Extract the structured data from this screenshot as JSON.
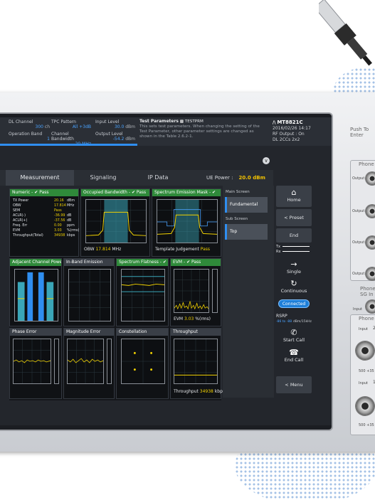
{
  "params": {
    "dl_channel_label": "DL Channel",
    "dl_channel_value": "300",
    "dl_channel_unit": "ch",
    "operation_band_label": "Operation Band",
    "operation_band_value": "1",
    "tpc_pattern_label": "TPC Pattern",
    "tpc_pattern_value": "All +3dB",
    "channel_bandwidth_label": "Channel Bandwidth",
    "channel_bandwidth_value": "20 MHz",
    "input_level_label": "Input Level",
    "input_level_value": "30.0",
    "input_level_unit": "dBm",
    "output_level_label": "Output Level",
    "output_level_value": "-54.2",
    "output_level_unit": "dBm"
  },
  "test_parameters": {
    "title": "Test Parameters",
    "code": "TESTPRM",
    "description": "This sets test parameters. When changing the setting of the Test Parameter, other parameter settings are changed as shown in the Table 2.6.2-1."
  },
  "device": {
    "model": "MT8821C",
    "date": "2016/02/26 14:17",
    "rf_output": "RF Output : On",
    "dl_mode": "DL 2CCs 2x2"
  },
  "tabs": [
    {
      "label": "Measurement"
    },
    {
      "label": "Signaling"
    },
    {
      "label": "IP Data"
    }
  ],
  "ue_power": {
    "label": "UE Power :",
    "value": "20.0 dBm"
  },
  "panels": {
    "numeric": {
      "title": "Numeric -",
      "status": "Pass"
    },
    "obw": {
      "title": "Occupied Bandwidth -",
      "status": "Pass",
      "label": "OBW",
      "value": "17.814",
      "unit": "MHz"
    },
    "sem": {
      "title": "Spectrum Emission Mask -",
      "status": "",
      "label": "Template Judgement",
      "value": "Pass"
    },
    "aclr": {
      "title": "Adjacent Channel Power"
    },
    "inband": {
      "title": "In-Band Emission"
    },
    "flatness": {
      "title": "Spectrum Flatness -"
    },
    "evm": {
      "title": "EVM -",
      "status": "Pass",
      "label": "EVM",
      "value": "3.03",
      "unit": "%(rms)"
    },
    "phase": {
      "title": "Phase Error"
    },
    "magnitude": {
      "title": "Magnitude Error"
    },
    "constellation": {
      "title": "Constellation"
    },
    "throughput": {
      "title": "Throughput",
      "label": "Throughput",
      "value": "34938",
      "unit": "kbp"
    }
  },
  "numeric_rows": [
    {
      "name": "TX Power",
      "value": "20.16",
      "unit": "dBm"
    },
    {
      "name": "OBW",
      "value": "17.814",
      "unit": "MHz"
    },
    {
      "name": "SEM",
      "value": "Pass",
      "unit": ""
    },
    {
      "name": "ACLR(-)",
      "value": "-36.99",
      "unit": "dB"
    },
    {
      "name": "ACLR(+)",
      "value": "-37.56",
      "unit": "dB"
    },
    {
      "name": "Freq. Err",
      "value": "0.00",
      "unit": "ppm"
    },
    {
      "name": "EVM",
      "value": "3.03",
      "unit": "%(rms)"
    },
    {
      "name": "Throughput(Total)",
      "value": "34938",
      "unit": "kbps"
    }
  ],
  "screen_select": {
    "main_label": "Main Screen",
    "main_value": "Fundamental",
    "sub_label": "Sub Screen",
    "sub_value": "Top"
  },
  "soft_buttons": {
    "home": "Home",
    "preset": "Preset",
    "end": "End",
    "tx": "Tx",
    "rx": "Rx",
    "single": "Single",
    "continuous": "Continuous",
    "connected": "Connected",
    "rsrp_label": "RSRP",
    "rsrp_value": "-86 to -88",
    "rsrp_unit": "dBm/15kHz",
    "start_call": "Start Call",
    "end_call": "End Call",
    "menu": "Menu"
  },
  "hardware": {
    "push_to_enter": "Push To Enter",
    "phone1": "Phone",
    "output": "Output",
    "phone_sg": "Phone SG In",
    "input": "Input",
    "phone2": "Phone",
    "input2": "Input",
    "num2": "2",
    "num1": "1",
    "warn": "500 +35",
    "main": "Main"
  }
}
